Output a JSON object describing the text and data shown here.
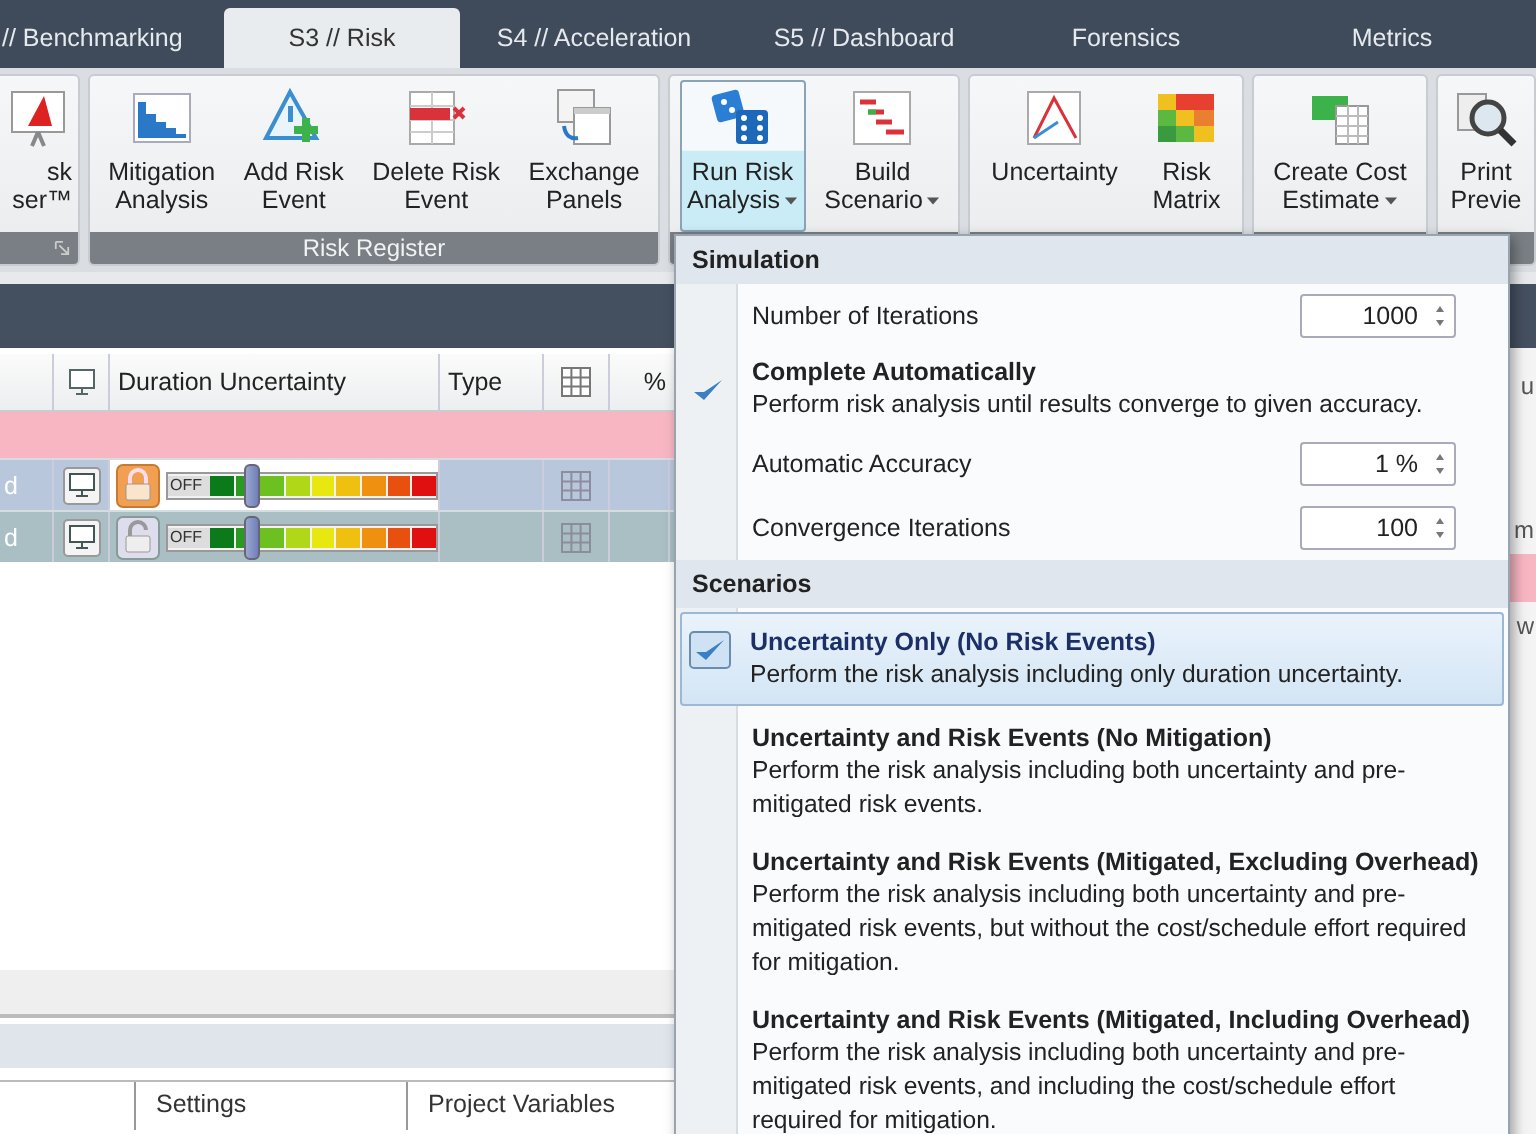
{
  "tabs": [
    {
      "label": "// Benchmarking",
      "selected": false
    },
    {
      "label": "S3 // Risk",
      "selected": true
    },
    {
      "label": "S4 // Acceleration",
      "selected": false
    },
    {
      "label": "S5 // Dashboard",
      "selected": false
    },
    {
      "label": "Forensics",
      "selected": false
    },
    {
      "label": "Metrics",
      "selected": false
    }
  ],
  "ribbon": {
    "groups": [
      {
        "buttons": [
          {
            "kind": "presenter",
            "lines": [
              "sk",
              "ser™"
            ],
            "dropdown": false,
            "open": false
          }
        ]
      },
      {
        "label": "Risk Register",
        "buttons": [
          {
            "kind": "bar-chart",
            "lines": [
              "Mitigation",
              "Analysis"
            ],
            "dropdown": false,
            "open": false
          },
          {
            "kind": "warning-add",
            "lines": [
              "Add Risk",
              "Event"
            ],
            "dropdown": false,
            "open": false
          },
          {
            "kind": "delete-row",
            "lines": [
              "Delete Risk",
              "Event"
            ],
            "dropdown": false,
            "open": false
          },
          {
            "kind": "exchange",
            "lines": [
              "Exchange",
              "Panels"
            ],
            "dropdown": false,
            "open": false
          }
        ]
      },
      {
        "buttons": [
          {
            "kind": "dice",
            "lines": [
              "Run Risk",
              "Analysis"
            ],
            "dropdown": true,
            "open": true
          },
          {
            "kind": "gantt",
            "lines": [
              "Build",
              "Scenario"
            ],
            "dropdown": true,
            "open": false
          }
        ]
      },
      {
        "buttons": [
          {
            "kind": "curve",
            "lines": [
              "Uncertainty"
            ],
            "dropdown": false,
            "open": false
          },
          {
            "kind": "heatmap",
            "lines": [
              "Risk",
              "Matrix"
            ],
            "dropdown": false,
            "open": false
          }
        ]
      },
      {
        "buttons": [
          {
            "kind": "money",
            "lines": [
              "Create Cost",
              "Estimate"
            ],
            "dropdown": true,
            "open": false
          }
        ]
      },
      {
        "buttons": [
          {
            "kind": "magnifier",
            "lines": [
              "Print",
              "Previe"
            ],
            "dropdown": false,
            "open": false
          }
        ]
      }
    ]
  },
  "grid": {
    "columns": [
      {
        "kind": "blank"
      },
      {
        "kind": "monitor"
      },
      {
        "kind": "text",
        "label": "Duration Uncertainty"
      },
      {
        "kind": "text",
        "label": "Type"
      },
      {
        "kind": "grid"
      },
      {
        "kind": "text",
        "label": "%"
      }
    ],
    "rows": [
      {
        "kind": "summary"
      },
      {
        "kind": "task",
        "cell": "d",
        "selected": true,
        "locked": true,
        "slider_label": "OFF",
        "level": 0.3
      },
      {
        "kind": "task",
        "cell": "d",
        "selected": false,
        "locked": false,
        "slider_label": "OFF",
        "level": 0.3
      }
    ]
  },
  "right_panel": {
    "header": "u",
    "rows": [
      "m",
      "w"
    ]
  },
  "bottom_tabs": [
    {
      "label": "Settings"
    },
    {
      "label": "Project Variables"
    }
  ],
  "menu": {
    "sections": [
      {
        "title": "Simulation",
        "items": [
          {
            "kind": "spin",
            "label": "Number of Iterations",
            "value": "1000"
          },
          {
            "kind": "check",
            "title": "Complete Automatically",
            "description": "Perform risk analysis until results converge to given accuracy.",
            "checked": true
          },
          {
            "kind": "spin",
            "label": "Automatic Accuracy",
            "value": "1 %"
          },
          {
            "kind": "spin",
            "label": "Convergence Iterations",
            "value": "100"
          }
        ]
      },
      {
        "title": "Scenarios",
        "items": [
          {
            "kind": "option",
            "title": "Uncertainty Only (No Risk Events)",
            "description": "Perform the risk analysis including only duration uncertainty.",
            "selected": true
          },
          {
            "kind": "option",
            "title": "Uncertainty and Risk Events (No Mitigation)",
            "description": "Perform the risk analysis including both uncertainty and pre-mitigated risk events.",
            "selected": false
          },
          {
            "kind": "option",
            "title": "Uncertainty and Risk Events (Mitigated, Excluding Overhead)",
            "description": "Perform the risk analysis including both uncertainty and pre-mitigated risk events, but without the cost/schedule effort required for mitigation.",
            "selected": false
          },
          {
            "kind": "option",
            "title": "Uncertainty and Risk Events (Mitigated, Including Overhead)",
            "description": "Perform the risk analysis including both uncertainty and pre-mitigated risk events, and including the cost/schedule effort required for mitigation.",
            "selected": false
          }
        ]
      }
    ]
  }
}
